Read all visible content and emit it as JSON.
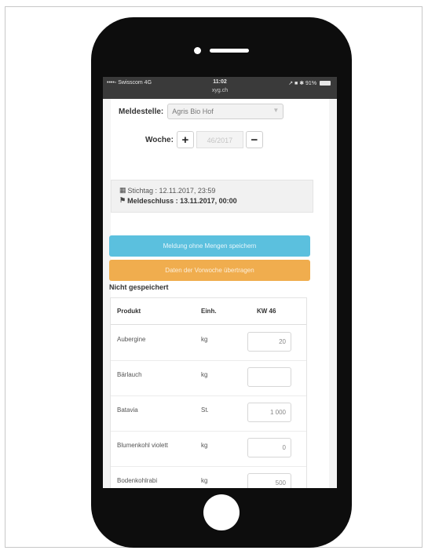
{
  "statusbar": {
    "carrier": "••••◦ Swisscom  4G",
    "time": "11:02",
    "url": "xyg.ch",
    "indicators": "↗ ■ ✱ 91%"
  },
  "form": {
    "meldestelle_label": "Meldestelle:",
    "meldestelle_value": "Agris Bio Hof",
    "woche_label": "Woche:",
    "woche_value": "46/2017",
    "plus_label": "+",
    "minus_label": "−"
  },
  "info": {
    "stichtag_icon": "▦",
    "stichtag": "Stichtag : 12.11.2017, 23:59",
    "meldeschluss_icon": "⚑",
    "meldeschluss": "Meldeschluss : 13.11.2017, 00:00"
  },
  "buttons": {
    "save_without_quantities": "Meldung ohne Mengen speichern",
    "copy_previous_week": "Daten der Vorwoche übertragen"
  },
  "status": "Nicht gespeichert",
  "table": {
    "headers": [
      "Produkt",
      "Einh.",
      "KW 46"
    ],
    "rows": [
      {
        "product": "Aubergine",
        "unit": "kg",
        "qty": "20"
      },
      {
        "product": "Bärlauch",
        "unit": "kg",
        "qty": ""
      },
      {
        "product": "Batavia",
        "unit": "St.",
        "qty": "1 000"
      },
      {
        "product": "Blumenkohl violett",
        "unit": "kg",
        "qty": "0"
      },
      {
        "product": "Bodenkohlrabi",
        "unit": "kg",
        "qty": "500"
      }
    ]
  },
  "colors": {
    "info_button": "#5bc0de",
    "warning_button": "#f0ad4e",
    "phone_body": "#0d0d0d",
    "status_bar": "#3a3a3a"
  }
}
